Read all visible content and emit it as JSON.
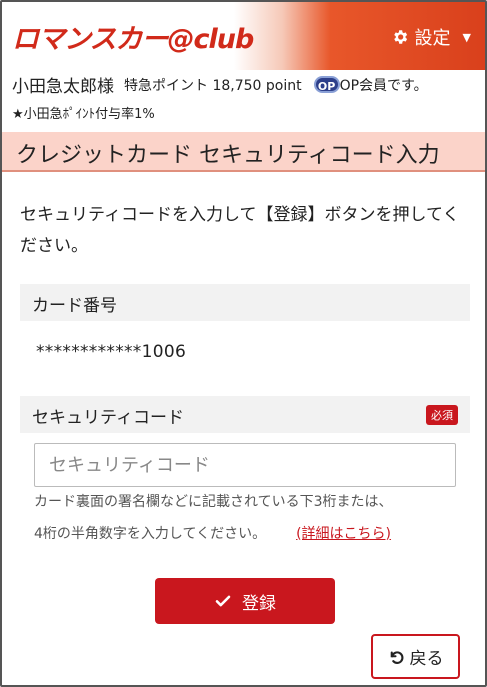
{
  "header": {
    "logo_text": "ロマンスカー@club",
    "settings_label": "設定",
    "brand_color": "#c9171e"
  },
  "user": {
    "name": "小田急太郎様",
    "points": "特急ポイント 18,750 point",
    "op_logo": "OP",
    "op_member": "OP会員です。",
    "point_rate": "★小田急ﾎﾟｲﾝﾄ付与率1%"
  },
  "page": {
    "title": "クレジットカード セキュリティコード入力",
    "instruction": "セキュリティコードを入力して【登録】ボタンを押してください。"
  },
  "card": {
    "label": "カード番号",
    "number": "************1006"
  },
  "security": {
    "label": "セキュリティコード",
    "required_badge": "必須",
    "placeholder": "セキュリティコード",
    "value": "",
    "hint_line1": "カード裏面の署名欄などに記載されている下3桁または、",
    "hint_line2": "4桁の半角数字を入力してください。",
    "detail_link": "(詳細はこちら)"
  },
  "actions": {
    "submit_label": "登録",
    "back_label": "戻る"
  },
  "icons": {
    "settings": "gear-icon",
    "submit": "check-icon",
    "back": "undo-icon"
  }
}
